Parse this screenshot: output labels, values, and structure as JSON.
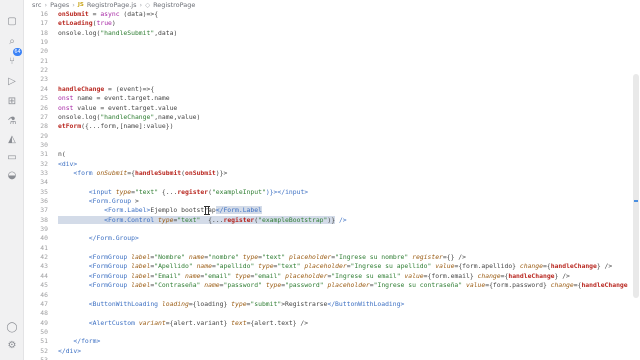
{
  "breadcrumb": {
    "parts": [
      "src",
      "Pages",
      "RegistroPage.js"
    ],
    "file_icon": "JS",
    "symbol": "RegistroPage"
  },
  "activity_bar": {
    "icons": [
      "explorer-icon",
      "search-icon",
      "source-control-icon",
      "run-debug-icon",
      "extensions-icon",
      "testing-icon",
      "azure-icon",
      "remote-explorer-icon",
      "docker-icon",
      "account-icon",
      "settings-icon"
    ],
    "badge": "64"
  },
  "editor": {
    "lines": [
      {
        "n": "16",
        "t": [
          [
            "onSubmit",
            "fn"
          ],
          [
            " = ",
            "pl"
          ],
          [
            "async",
            "kw"
          ],
          [
            " (data)=>{",
            "pl"
          ]
        ]
      },
      {
        "n": "17",
        "t": [
          [
            "etLoading",
            "fn"
          ],
          [
            "(",
            "pl"
          ],
          [
            "true",
            "kw"
          ],
          [
            ")",
            "pl"
          ]
        ]
      },
      {
        "n": "18",
        "t": [
          [
            "onsole.log(",
            "pl"
          ],
          [
            "\"handleSubmit\"",
            "str"
          ],
          [
            ",data)",
            "pl"
          ]
        ]
      },
      {
        "n": "19",
        "t": []
      },
      {
        "n": "20",
        "t": []
      },
      {
        "n": "21",
        "t": []
      },
      {
        "n": "22",
        "t": []
      },
      {
        "n": "23",
        "t": []
      },
      {
        "n": "24",
        "t": [
          [
            "handleChange",
            "fn"
          ],
          [
            " = (event)=>{",
            "pl"
          ]
        ]
      },
      {
        "n": "25",
        "t": [
          [
            "onst",
            "kw"
          ],
          [
            " name = event.target.name",
            "pl"
          ]
        ]
      },
      {
        "n": "26",
        "t": [
          [
            "onst",
            "kw"
          ],
          [
            " value = event.target.value",
            "pl"
          ]
        ]
      },
      {
        "n": "27",
        "t": [
          [
            "onsole.log(",
            "pl"
          ],
          [
            "\"handleChange\"",
            "str"
          ],
          [
            ",name,value)",
            "pl"
          ]
        ]
      },
      {
        "n": "28",
        "t": [
          [
            "etForm",
            "fn"
          ],
          [
            "({...form,[name]:value})",
            "pl"
          ]
        ]
      },
      {
        "n": "29",
        "t": []
      },
      {
        "n": "30",
        "t": []
      },
      {
        "n": "31",
        "t": [
          [
            "n(",
            "pl"
          ]
        ]
      },
      {
        "n": "32",
        "t": [
          [
            "<div>",
            "tag"
          ]
        ]
      },
      {
        "n": "33",
        "t": [
          [
            "    <form ",
            "tag"
          ],
          [
            "onSubmit",
            "attr"
          ],
          [
            "={",
            "pl"
          ],
          [
            "handleSubmit",
            "fn"
          ],
          [
            "(",
            "pl"
          ],
          [
            "onSubmit",
            "fn"
          ],
          [
            ")}>",
            "pl"
          ]
        ]
      },
      {
        "n": "34",
        "t": []
      },
      {
        "n": "35",
        "t": [
          [
            "        <input ",
            "tag"
          ],
          [
            "type",
            "attr"
          ],
          [
            "=",
            "pl"
          ],
          [
            "\"text\"",
            "str"
          ],
          [
            " {...",
            "pl"
          ],
          [
            "register",
            "fn"
          ],
          [
            "(",
            "pl"
          ],
          [
            "\"exampleInput\"",
            "str"
          ],
          [
            ")}></input>",
            "tag"
          ]
        ]
      },
      {
        "n": "36",
        "t": [
          [
            "        <Form.Group",
            "tag"
          ],
          [
            " >",
            "pl"
          ]
        ]
      },
      {
        "n": "37",
        "t": [
          [
            "            <Form.Label>",
            "tag"
          ],
          [
            "Ejemplo bootstrap",
            "pl"
          ],
          [
            "</Form.Label",
            "tag",
            "sel"
          ]
        ]
      },
      {
        "n": "38",
        "t": [
          [
            "            <Form.Control ",
            "tag",
            "sel"
          ],
          [
            "type",
            "attr",
            "sel"
          ],
          [
            "=",
            "pl",
            "sel"
          ],
          [
            "\"text\"",
            "str",
            "sel"
          ],
          [
            "  {...",
            "pl",
            "sel"
          ],
          [
            "register",
            "fn",
            "sel"
          ],
          [
            "(",
            "pl",
            "sel"
          ],
          [
            "\"exampleBootstrap\"",
            "str",
            "sel"
          ],
          [
            ")}",
            "pl",
            "sel"
          ],
          [
            " />",
            "tag"
          ]
        ]
      },
      {
        "n": "39",
        "t": []
      },
      {
        "n": "40",
        "t": [
          [
            "        </Form.Group>",
            "tag"
          ]
        ]
      },
      {
        "n": "41",
        "t": []
      },
      {
        "n": "42",
        "t": [
          [
            "        <FormGroup ",
            "tag"
          ],
          [
            "label",
            "attr"
          ],
          [
            "=",
            "pl"
          ],
          [
            "\"Nombre\"",
            "str"
          ],
          [
            " ",
            "pl"
          ],
          [
            "name",
            "attr"
          ],
          [
            "=",
            "pl"
          ],
          [
            "\"nombre\"",
            "str"
          ],
          [
            " ",
            "pl"
          ],
          [
            "type",
            "attr"
          ],
          [
            "=",
            "pl"
          ],
          [
            "\"text\"",
            "str"
          ],
          [
            " ",
            "pl"
          ],
          [
            "placeholder",
            "attr"
          ],
          [
            "=",
            "pl"
          ],
          [
            "\"Ingrese su nombre\"",
            "str"
          ],
          [
            " ",
            "pl"
          ],
          [
            "register",
            "attr"
          ],
          [
            "={} />",
            "pl"
          ]
        ]
      },
      {
        "n": "43",
        "t": [
          [
            "        <FormGroup ",
            "tag"
          ],
          [
            "label",
            "attr"
          ],
          [
            "=",
            "pl"
          ],
          [
            "\"Apellido\"",
            "str"
          ],
          [
            " ",
            "pl"
          ],
          [
            "name",
            "attr"
          ],
          [
            "=",
            "pl"
          ],
          [
            "\"apellido\"",
            "str"
          ],
          [
            " ",
            "pl"
          ],
          [
            "type",
            "attr"
          ],
          [
            "=",
            "pl"
          ],
          [
            "\"text\"",
            "str"
          ],
          [
            " ",
            "pl"
          ],
          [
            "placeholder",
            "attr"
          ],
          [
            "=",
            "pl"
          ],
          [
            "\"Ingrese su apellido\"",
            "str"
          ],
          [
            " ",
            "pl"
          ],
          [
            "value",
            "attr"
          ],
          [
            "={form.apellido} ",
            "pl"
          ],
          [
            "change",
            "attr"
          ],
          [
            "={",
            "pl"
          ],
          [
            "handleChange",
            "fn"
          ],
          [
            "} />",
            "pl"
          ]
        ]
      },
      {
        "n": "44",
        "t": [
          [
            "        <FormGroup ",
            "tag"
          ],
          [
            "label",
            "attr"
          ],
          [
            "=",
            "pl"
          ],
          [
            "\"Email\"",
            "str"
          ],
          [
            " ",
            "pl"
          ],
          [
            "name",
            "attr"
          ],
          [
            "=",
            "pl"
          ],
          [
            "\"email\"",
            "str"
          ],
          [
            " ",
            "pl"
          ],
          [
            "type",
            "attr"
          ],
          [
            "=",
            "pl"
          ],
          [
            "\"email\"",
            "str"
          ],
          [
            " ",
            "pl"
          ],
          [
            "placeholder",
            "attr"
          ],
          [
            "=",
            "pl"
          ],
          [
            "\"Ingrese su email\"",
            "str"
          ],
          [
            " ",
            "pl"
          ],
          [
            "value",
            "attr"
          ],
          [
            "={form.email} ",
            "pl"
          ],
          [
            "change",
            "attr"
          ],
          [
            "={",
            "pl"
          ],
          [
            "handleChange",
            "fn"
          ],
          [
            "} />",
            "pl"
          ]
        ]
      },
      {
        "n": "45",
        "t": [
          [
            "        <FormGroup ",
            "tag"
          ],
          [
            "label",
            "attr"
          ],
          [
            "=",
            "pl"
          ],
          [
            "\"Contraseña\"",
            "str"
          ],
          [
            " ",
            "pl"
          ],
          [
            "name",
            "attr"
          ],
          [
            "=",
            "pl"
          ],
          [
            "\"password\"",
            "str"
          ],
          [
            " ",
            "pl"
          ],
          [
            "type",
            "attr"
          ],
          [
            "=",
            "pl"
          ],
          [
            "\"password\"",
            "str"
          ],
          [
            " ",
            "pl"
          ],
          [
            "placeholder",
            "attr"
          ],
          [
            "=",
            "pl"
          ],
          [
            "\"Ingrese su contraseña\"",
            "str"
          ],
          [
            " ",
            "pl"
          ],
          [
            "value",
            "attr"
          ],
          [
            "={form.password} ",
            "pl"
          ],
          [
            "change",
            "attr"
          ],
          [
            "={",
            "pl"
          ],
          [
            "handleChange",
            "fn"
          ]
        ]
      },
      {
        "n": "46",
        "t": []
      },
      {
        "n": "47",
        "t": [
          [
            "        <ButtonWithLoading ",
            "tag"
          ],
          [
            "loading",
            "attr"
          ],
          [
            "={loading} ",
            "pl"
          ],
          [
            "type",
            "attr"
          ],
          [
            "=",
            "pl"
          ],
          [
            "\"submit\"",
            "str"
          ],
          [
            ">Registrarse",
            "pl"
          ],
          [
            "</ButtonWithLoading>",
            "tag"
          ]
        ]
      },
      {
        "n": "48",
        "t": []
      },
      {
        "n": "49",
        "t": [
          [
            "        <AlertCustom ",
            "tag"
          ],
          [
            "variant",
            "attr"
          ],
          [
            "={alert.variant} ",
            "pl"
          ],
          [
            "text",
            "attr"
          ],
          [
            "={alert.text} />",
            "pl"
          ]
        ]
      },
      {
        "n": "50",
        "t": []
      },
      {
        "n": "51",
        "t": [
          [
            "    </form>",
            "tag"
          ]
        ]
      },
      {
        "n": "52",
        "t": [
          [
            "</div>",
            "tag"
          ]
        ]
      },
      {
        "n": "53",
        "t": []
      }
    ]
  }
}
